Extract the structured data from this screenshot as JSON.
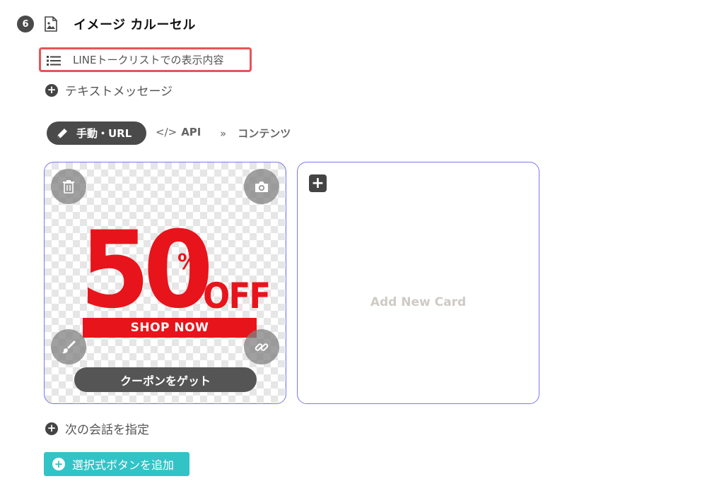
{
  "header": {
    "step_number": "6",
    "title": "イメージ カルーセル",
    "icon": "image-file-icon"
  },
  "line_list": {
    "label": "LINEトークリストでの表示内容",
    "icon": "list-icon",
    "highlight_color": "#e65557"
  },
  "add_text_message": {
    "label": "テキストメッセージ",
    "icon": "plus-circle-icon"
  },
  "tabs": {
    "manual": {
      "label": "手動・URL",
      "icon": "pencil-icon"
    },
    "api": {
      "code_glyph": "</>",
      "label": "API"
    },
    "content": {
      "chevron_glyph": "»",
      "label": "コンテンツ"
    }
  },
  "card": {
    "promo_big": "50",
    "promo_percent": "%",
    "promo_off": "OFF",
    "promo_shop_now": "SHOP NOW",
    "button_label": "クーポンをゲット",
    "icons": [
      "trash-icon",
      "camera-icon",
      "brush-icon",
      "link-icon"
    ]
  },
  "new_card": {
    "label": "Add New Card",
    "plus_glyph": "+"
  },
  "next_conversation": {
    "label": "次の会話を指定",
    "icon": "plus-circle-icon"
  },
  "choice_button": {
    "label": "選択式ボタンを追加",
    "color": "#32c3c7"
  },
  "colors": {
    "card_border": "#7b78ea",
    "promo_red": "#e8141b",
    "dark": "#4a4a4a"
  }
}
